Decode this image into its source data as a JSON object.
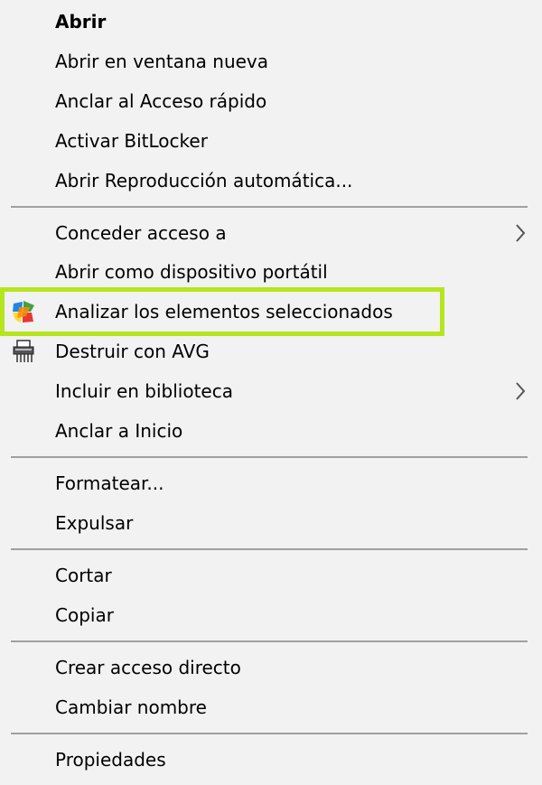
{
  "menu": {
    "items": [
      {
        "label": "Abrir"
      },
      {
        "label": "Abrir en ventana nueva"
      },
      {
        "label": "Anclar al Acceso rápido"
      },
      {
        "label": "Activar BitLocker"
      },
      {
        "label": "Abrir Reproducción automática..."
      },
      {
        "label": "Conceder acceso a"
      },
      {
        "label": "Abrir como dispositivo portátil"
      },
      {
        "label": "Analizar los elementos seleccionados",
        "icon": "avg-scan-icon"
      },
      {
        "label": "Destruir con AVG",
        "icon": "shredder-icon"
      },
      {
        "label": "Incluir en biblioteca"
      },
      {
        "label": "Anclar a Inicio"
      },
      {
        "label": "Formatear..."
      },
      {
        "label": "Expulsar"
      },
      {
        "label": "Cortar"
      },
      {
        "label": "Copiar"
      },
      {
        "label": "Crear acceso directo"
      },
      {
        "label": "Cambiar nombre"
      },
      {
        "label": "Propiedades"
      }
    ],
    "highlight_color": "#b5e61d",
    "background_color": "#f2f2f2",
    "separator_color": "#a0a0a0"
  }
}
